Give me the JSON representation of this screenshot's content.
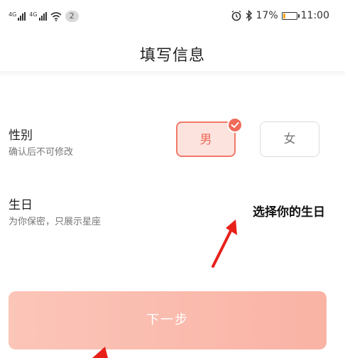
{
  "status_bar": {
    "signal1_label": "4G",
    "signal2_label": "4G",
    "notification_count": "2",
    "battery_percent": "17%",
    "time": "11:00",
    "icons": [
      "alarm-icon",
      "bluetooth-icon",
      "battery-icon",
      "wifi-icon",
      "signal-icon"
    ],
    "battery_level": 0.17,
    "battery_color": "#f5a623"
  },
  "header": {
    "title": "填写信息"
  },
  "gender": {
    "label": "性别",
    "hint": "确认后不可修改",
    "options": [
      "男",
      "女"
    ],
    "selected": "男",
    "accent": "#ef6b5a"
  },
  "birthday": {
    "label": "生日",
    "hint": "为你保密，只展示星座",
    "placeholder": "选择你的生日"
  },
  "next_button": {
    "label": "下一步",
    "color": "#fbc5b8"
  }
}
